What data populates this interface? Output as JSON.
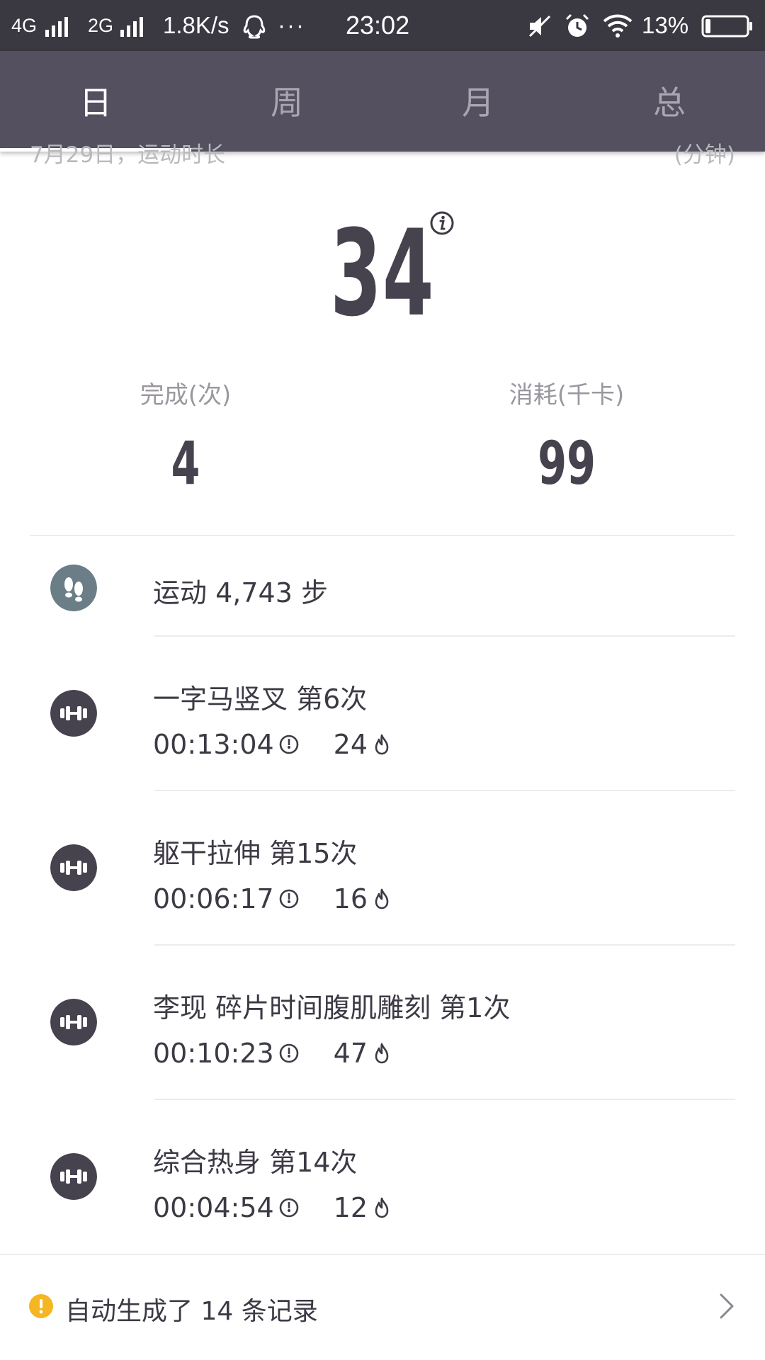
{
  "status_bar": {
    "network1": "4G",
    "network2": "2G",
    "speed": "1.8K/s",
    "more": "···",
    "time": "23:02",
    "battery": "13%"
  },
  "tabs": [
    {
      "label": "日",
      "active": true
    },
    {
      "label": "周",
      "active": false
    },
    {
      "label": "月",
      "active": false
    },
    {
      "label": "总",
      "active": false
    }
  ],
  "summary": {
    "date_label": "7月29日，运动时长",
    "unit_label": "(分钟)",
    "duration": "34",
    "completed_label": "完成(次)",
    "completed_value": "4",
    "calories_label": "消耗(千卡)",
    "calories_value": "99"
  },
  "steps": {
    "text": "运动 4,743 步",
    "icon": "footprints-icon"
  },
  "workouts": [
    {
      "title": "一字马竖叉 第6次",
      "duration": "00:13:04",
      "kcal": "24",
      "icon": "dumbbell-icon"
    },
    {
      "title": "躯干拉伸 第15次",
      "duration": "00:06:17",
      "kcal": "16",
      "icon": "dumbbell-icon"
    },
    {
      "title": "李现 碎片时间腹肌雕刻 第1次",
      "duration": "00:10:23",
      "kcal": "47",
      "icon": "dumbbell-icon"
    },
    {
      "title": "综合热身 第14次",
      "duration": "00:04:54",
      "kcal": "12",
      "icon": "dumbbell-icon"
    }
  ],
  "footer": {
    "text": "自动生成了 14 条记录",
    "icon": "warning-icon",
    "chevron": "chevron-right-icon"
  },
  "colors": {
    "status_bar_bg": "#3a3841",
    "header_bg": "#545060",
    "icon_dark": "#46424e",
    "steps_icon": "#6b7d86",
    "warning": "#f5b623"
  }
}
